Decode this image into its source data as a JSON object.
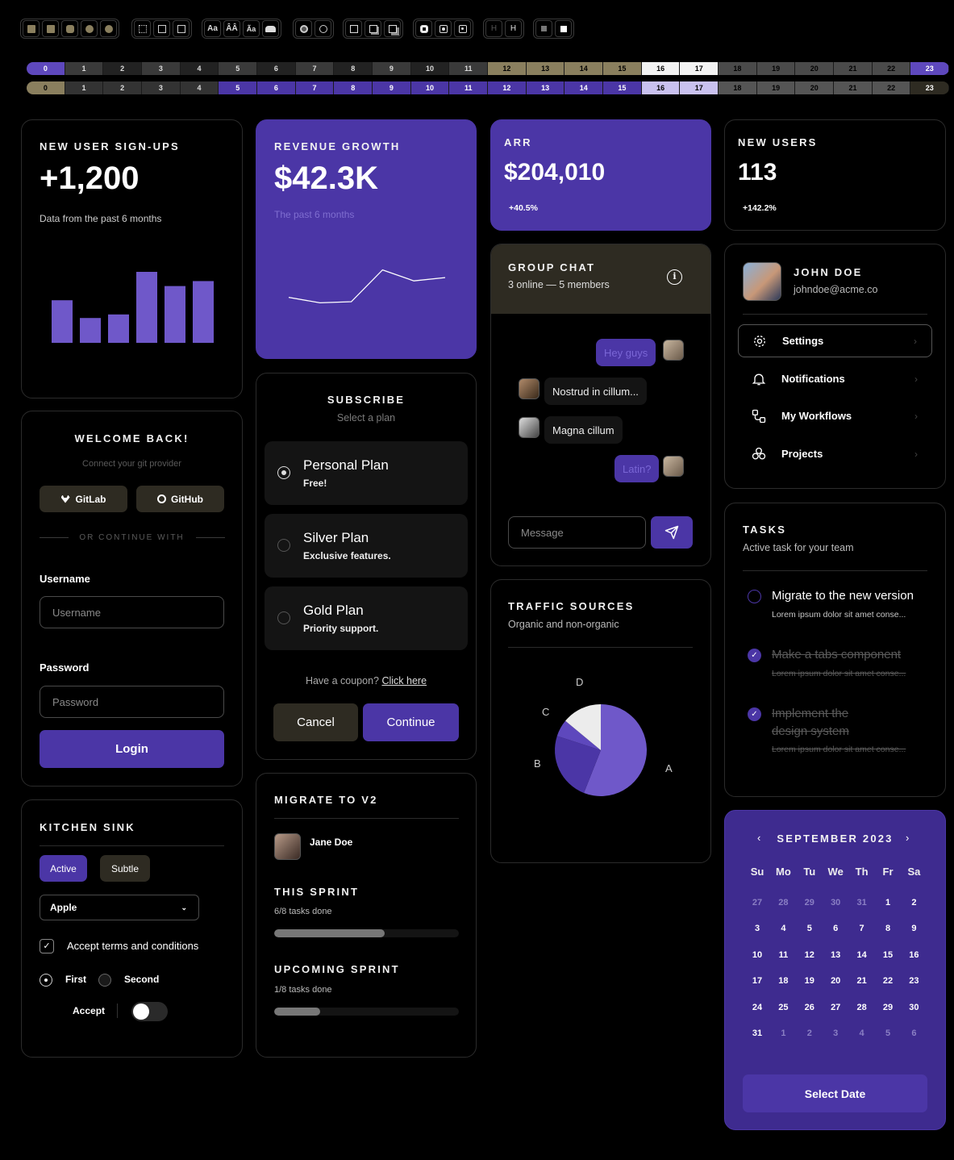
{
  "toolbar": {
    "groups": [
      {
        "items": [
          "fill-square-1",
          "fill-square-2",
          "fill-square-3",
          "fill-circle-1",
          "fill-circle-2"
        ]
      },
      {
        "items": [
          "border-dotted",
          "border-square",
          "border-square-2"
        ]
      },
      {
        "items": [
          "Aa",
          "AA",
          "Aa",
          "cloud"
        ]
      },
      {
        "items": [
          "dot-circle",
          "ring-circle"
        ]
      },
      {
        "items": [
          "shadow-none",
          "shadow-sm",
          "shadow-md"
        ]
      },
      {
        "items": [
          "radius-sm",
          "radius-md",
          "radius-lg"
        ]
      },
      {
        "items": [
          "H",
          "H"
        ]
      },
      {
        "items": [
          "small-square",
          "filled-square"
        ]
      }
    ]
  },
  "scales": [
    {
      "steps": [
        "0",
        "1",
        "2",
        "3",
        "4",
        "5",
        "6",
        "7",
        "8",
        "9",
        "10",
        "11",
        "12",
        "13",
        "14",
        "15",
        "16",
        "17",
        "18",
        "19",
        "20",
        "21",
        "22",
        "23"
      ]
    },
    {
      "steps": [
        "0",
        "1",
        "2",
        "3",
        "4",
        "5",
        "6",
        "7",
        "8",
        "9",
        "10",
        "11",
        "12",
        "13",
        "14",
        "15",
        "16",
        "17",
        "18",
        "19",
        "20",
        "21",
        "22",
        "23"
      ]
    }
  ],
  "signups": {
    "title": "NEW USER SIGN-UPS",
    "value": "+1,200",
    "caption": "Data from the past 6 months",
    "bars": [
      0.6,
      0.35,
      0.4,
      1.0,
      0.8,
      0.87
    ]
  },
  "revenue": {
    "title": "REVENUE GROWTH",
    "value": "$42.3K",
    "caption": "The past 6 months",
    "line": [
      0.3,
      0.2,
      0.22,
      0.8,
      0.6,
      0.66
    ]
  },
  "arr": {
    "title": "ARR",
    "value": "$204,010",
    "delta": "+40.5%"
  },
  "new_users": {
    "title": "NEW USERS",
    "value": "113",
    "delta": "+142.2%"
  },
  "login": {
    "title": "WELCOME BACK!",
    "subtitle": "Connect your git provider",
    "gitlab": "GitLab",
    "github": "GitHub",
    "divider": "OR CONTINUE WITH",
    "username_label": "Username",
    "username_placeholder": "Username",
    "password_label": "Password",
    "password_placeholder": "Password",
    "login_button": "Login"
  },
  "subscribe": {
    "title": "SUBSCRIBE",
    "subtitle": "Select a plan",
    "plans": [
      {
        "name": "Personal Plan",
        "desc": "Free!",
        "selected": true
      },
      {
        "name": "Silver Plan",
        "desc": "Exclusive features.",
        "selected": false
      },
      {
        "name": "Gold Plan",
        "desc": "Priority support.",
        "selected": false
      }
    ],
    "coupon_text": "Have a coupon?",
    "coupon_link": "Click here",
    "cancel": "Cancel",
    "continue": "Continue"
  },
  "chat": {
    "title": "GROUP CHAT",
    "status": "3 online — 5 members",
    "messages": [
      {
        "text": "Hey guys",
        "mine": true
      },
      {
        "text": "Nostrud in cillum...",
        "mine": false
      },
      {
        "text": "Magna cillum",
        "mine": false
      },
      {
        "text": "Latin?",
        "mine": true
      }
    ],
    "input_placeholder": "Message"
  },
  "profile": {
    "name": "JOHN DOE",
    "email": "johndoe@acme.co",
    "menu": [
      {
        "label": "Settings",
        "icon": "gear-icon"
      },
      {
        "label": "Notifications",
        "icon": "bell-icon"
      },
      {
        "label": "My Workflows",
        "icon": "workflow-icon"
      },
      {
        "label": "Projects",
        "icon": "projects-icon"
      }
    ]
  },
  "tasks": {
    "title": "TASKS",
    "subtitle": "Active task for your team",
    "items": [
      {
        "title": "Migrate to the new version",
        "desc": "Lorem ipsum dolor sit amet conse...",
        "done": false
      },
      {
        "title": "Make a tabs component",
        "desc": "Lorem ipsum dolor sit amet conse...",
        "done": true
      },
      {
        "title": "Implement the design system",
        "desc": "Lorem ipsum dolor sit amet conse...",
        "done": true
      }
    ]
  },
  "kitchen": {
    "title": "KITCHEN SINK",
    "active": "Active",
    "subtle": "Subtle",
    "select_value": "Apple",
    "checkbox_label": "Accept terms and conditions",
    "radio_first": "First",
    "radio_second": "Second",
    "switch_label": "Accept"
  },
  "migrate": {
    "title": "MIGRATE TO V2",
    "user": "Jane Doe",
    "sprint_title": "THIS SPRINT",
    "sprint_caption": "6/8 tasks done",
    "sprint_progress": 0.6,
    "upcoming_title": "UPCOMING SPRINT",
    "upcoming_caption": "1/8 tasks done",
    "upcoming_progress": 0.25
  },
  "traffic": {
    "title": "TRAFFIC SOURCES",
    "subtitle": "Organic and non-organic",
    "colors": [
      "#6f58c9",
      "#4b36a6",
      "#5e48bd",
      "#ececec"
    ]
  },
  "chart_data": {
    "type": "pie",
    "categories": [
      "A",
      "B",
      "C",
      "D"
    ],
    "values": [
      56,
      24,
      6,
      14
    ]
  },
  "calendar": {
    "title": "SEPTEMBER 2023",
    "weekdays": [
      "Su",
      "Mo",
      "Tu",
      "We",
      "Th",
      "Fr",
      "Sa"
    ],
    "weeks": [
      [
        "27",
        "28",
        "29",
        "30",
        "31",
        "1",
        "2"
      ],
      [
        "3",
        "4",
        "5",
        "6",
        "7",
        "8",
        "9"
      ],
      [
        "10",
        "11",
        "12",
        "13",
        "14",
        "15",
        "16"
      ],
      [
        "17",
        "18",
        "19",
        "20",
        "21",
        "22",
        "23"
      ],
      [
        "24",
        "25",
        "26",
        "27",
        "28",
        "29",
        "30"
      ],
      [
        "31",
        "1",
        "2",
        "3",
        "4",
        "5",
        "6"
      ]
    ],
    "button": "Select Date"
  },
  "colors": {
    "accent": "#4b36a6",
    "accent_light": "#6f58c9",
    "muted": "#8a7f5e"
  }
}
